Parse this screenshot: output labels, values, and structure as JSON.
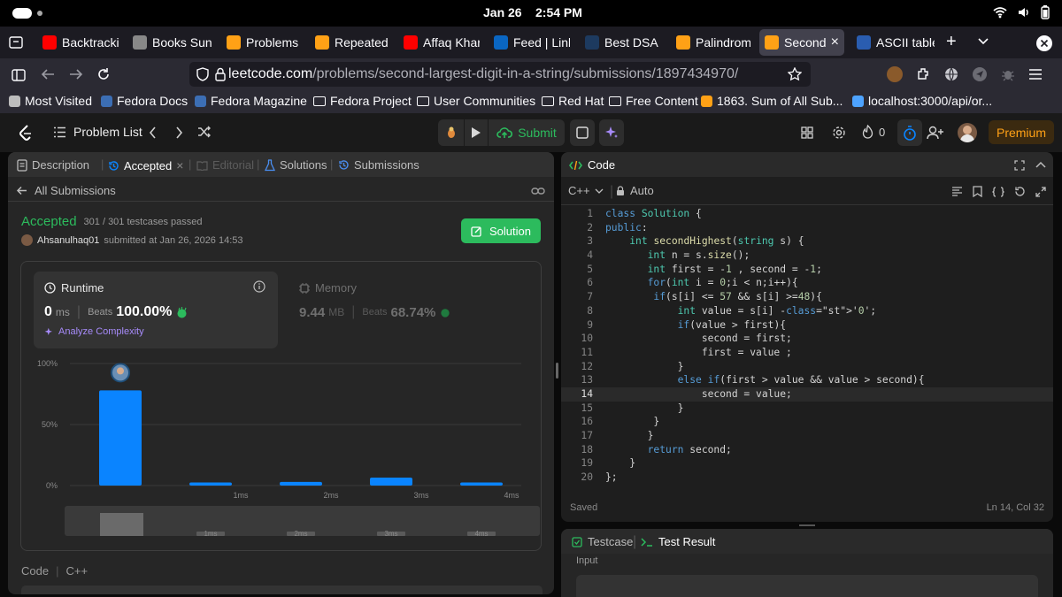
{
  "os": {
    "date": "Jan 26",
    "time": "2:54 PM"
  },
  "browser": {
    "tabs": [
      {
        "label": "Backtracki",
        "icon": "youtube-icon",
        "color": "#ff0000"
      },
      {
        "label": "Books Sun",
        "icon": "openai-icon",
        "color": "#888888"
      },
      {
        "label": "Problems",
        "icon": "leetcode-icon",
        "color": "#ffa116"
      },
      {
        "label": "Repeated",
        "icon": "leetcode-icon",
        "color": "#ffa116"
      },
      {
        "label": "Affaq Khar",
        "icon": "youtube-icon",
        "color": "#ff0000"
      },
      {
        "label": "Feed | Link",
        "icon": "linkedin-icon",
        "color": "#0a66c2"
      },
      {
        "label": "Best DSA",
        "icon": "site-icon",
        "color": "#1d3a5f"
      },
      {
        "label": "Palindrome",
        "icon": "leetcode-icon",
        "color": "#ffa116"
      },
      {
        "label": "Second",
        "icon": "leetcode-icon",
        "color": "#ffa116"
      },
      {
        "label": "ASCII table",
        "icon": "ascii-icon",
        "color": "#2a5db0"
      }
    ],
    "url_domain": "leetcode.com",
    "url_path": "/problems/second-largest-digit-in-a-string/submissions/1897434970/",
    "bookmarks": [
      "Most Visited",
      "Fedora Docs",
      "Fedora Magazine",
      "Fedora Project",
      "User Communities",
      "Red Hat",
      "Free Content",
      "1863. Sum of All Sub...",
      "localhost:3000/api/or..."
    ]
  },
  "lc": {
    "problem_list": "Problem List",
    "submit": "Submit",
    "streak": "0",
    "premium": "Premium"
  },
  "left": {
    "tabs": {
      "description": "Description",
      "accepted": "Accepted",
      "editorial": "Editorial",
      "solutions": "Solutions",
      "submissions": "Submissions"
    },
    "all_submissions": "All Submissions",
    "status": "Accepted",
    "testcases": "301 / 301 testcases passed",
    "user": "Ahsanulhaq01",
    "submitted_at": "submitted at Jan 26, 2026 14:53",
    "solution_button": "Solution",
    "runtime": {
      "label": "Runtime",
      "value": "0",
      "unit": "ms",
      "beats_label": "Beats",
      "beats": "100.00%"
    },
    "memory": {
      "label": "Memory",
      "value": "9.44",
      "unit": "MB",
      "beats_label": "Beats",
      "beats": "68.74%"
    },
    "analyze": "Analyze Complexity",
    "code_footer": {
      "label": "Code",
      "lang": "C++"
    }
  },
  "chart_data": {
    "type": "bar",
    "categories": [
      "0ms",
      "1ms",
      "2ms",
      "3ms",
      "4ms"
    ],
    "values": [
      78,
      2.5,
      3,
      6.5,
      2.5
    ],
    "ylim": [
      0,
      100
    ],
    "ytick_labels": [
      "100%",
      "50%",
      "0%"
    ],
    "xtick_labels": [
      "",
      "1ms",
      "2ms",
      "3ms",
      "4ms"
    ],
    "grid": true,
    "highlight_color": "#0a84ff"
  },
  "editor": {
    "title": "Code",
    "lang": "C++",
    "mode": "Auto",
    "saved": "Saved",
    "cursor": "Ln 14, Col 32",
    "current_line": 14,
    "lines": [
      "class Solution {",
      "public:",
      "    int secondHighest(string s) {",
      "       int n = s.size();",
      "       int first = -1 , second = -1;",
      "       for(int i = 0;i < n;i++){",
      "        if(s[i] <= 57 && s[i] >=48){",
      "            int value = s[i] -'0';",
      "            if(value > first){",
      "                second = first;",
      "                first = value ;",
      "            }",
      "            else if(first > value && value > second){",
      "                second = value;",
      "            }",
      "        }",
      "       }",
      "       return second;",
      "    }",
      "};"
    ]
  },
  "bottom": {
    "testcase": "Testcase",
    "test_result": "Test Result",
    "input_label": "Input"
  }
}
